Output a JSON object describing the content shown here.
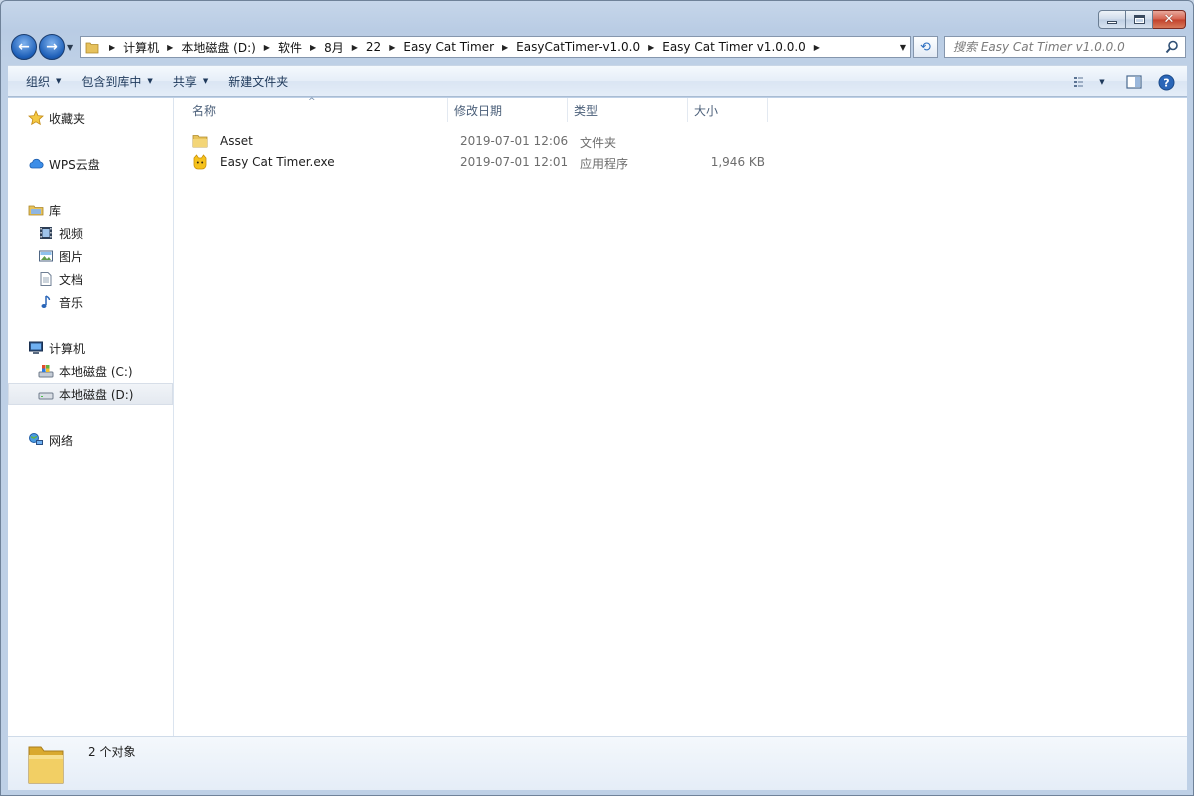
{
  "window": {
    "buttons": {
      "minimize": "minimize-icon",
      "maximize": "maximize-icon",
      "close": "close-icon"
    }
  },
  "address": {
    "breadcrumbs": [
      "计算机",
      "本地磁盘 (D:)",
      "软件",
      "8月",
      "22",
      "Easy Cat Timer",
      "EasyCatTimer-v1.0.0",
      "Easy Cat Timer v1.0.0.0"
    ]
  },
  "search": {
    "placeholder": "搜索 Easy Cat Timer v1.0.0.0"
  },
  "toolbar": {
    "organize": "组织",
    "include_library": "包含到库中",
    "share": "共享",
    "new_folder": "新建文件夹"
  },
  "nav": {
    "favorites": "收藏夹",
    "wps": "WPS云盘",
    "library": "库",
    "videos": "视频",
    "pictures": "图片",
    "documents": "文档",
    "music": "音乐",
    "computer": "计算机",
    "drive_c": "本地磁盘 (C:)",
    "drive_d": "本地磁盘 (D:)",
    "network": "网络"
  },
  "columns": {
    "name": "名称",
    "modified": "修改日期",
    "type": "类型",
    "size": "大小"
  },
  "files": [
    {
      "name": "Asset",
      "modified": "2019-07-01 12:06",
      "type": "文件夹",
      "size": ""
    },
    {
      "name": "Easy Cat Timer.exe",
      "modified": "2019-07-01 12:01",
      "type": "应用程序",
      "size": "1,946 KB"
    }
  ],
  "status": {
    "count": "2 个对象"
  },
  "colors": {
    "accent": "#1d5fb8",
    "folder": "#e8c35a",
    "selected_bg": "#e4e9f0"
  }
}
